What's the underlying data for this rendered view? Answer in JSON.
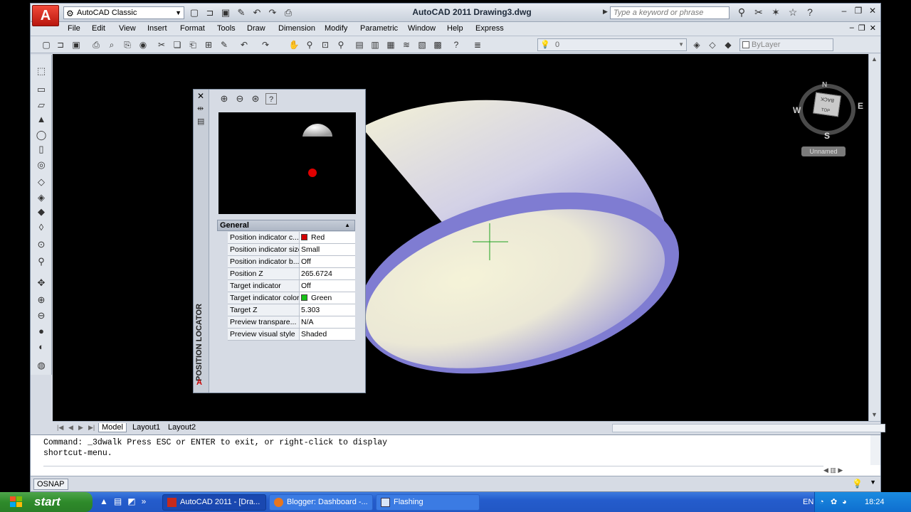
{
  "app": {
    "title": "AutoCAD 2011    Drawing3.dwg",
    "logo": "A",
    "workspace": "AutoCAD Classic",
    "search_placeholder": "Type a keyword or phrase"
  },
  "menu": [
    "File",
    "Edit",
    "View",
    "Insert",
    "Format",
    "Tools",
    "Draw",
    "Dimension",
    "Modify",
    "Parametric",
    "Window",
    "Help",
    "Express"
  ],
  "toolbar": {
    "layer_value": "0",
    "bylayer_value": "ByLayer"
  },
  "viewcube": {
    "n": "N",
    "s": "S",
    "e": "E",
    "w": "W",
    "face_back": "BACK",
    "face_top": "TOP",
    "ucs_label": "Unnamed"
  },
  "panel": {
    "title": "POSITION LOCATOR",
    "section": "General",
    "properties": [
      {
        "name": "Position indicator c...",
        "value": "Red",
        "swatch": "#d40000"
      },
      {
        "name": "Position indicator size",
        "value": "Small"
      },
      {
        "name": "Position indicator b...",
        "value": "Off"
      },
      {
        "name": "Position Z",
        "value": "265.6724"
      },
      {
        "name": "Target indicator",
        "value": "Off"
      },
      {
        "name": "Target indicator color",
        "value": "Green",
        "swatch": "#17c117"
      },
      {
        "name": "Target Z",
        "value": "5.303"
      },
      {
        "name": "Preview transpare...",
        "value": "N/A"
      },
      {
        "name": "Preview visual style",
        "value": "Shaded"
      }
    ]
  },
  "layout_tabs": [
    "Model",
    "Layout1",
    "Layout2"
  ],
  "command": {
    "line1": "Command: _3dwalk Press ESC or ENTER to exit, or right-click to display",
    "line2": "shortcut-menu."
  },
  "status": {
    "osnap": "OSNAP"
  },
  "taskbar": {
    "start": "start",
    "tasks": [
      {
        "label": "AutoCAD 2011 - [Dra..."
      },
      {
        "label": "Blogger: Dashboard -..."
      },
      {
        "label": "Flashing"
      }
    ],
    "lang": "EN",
    "clock": "18:24"
  },
  "colors": {
    "accent": "#2257c4",
    "dome_lavender": "#8a86d6",
    "dome_cream": "#f3f1d6"
  }
}
